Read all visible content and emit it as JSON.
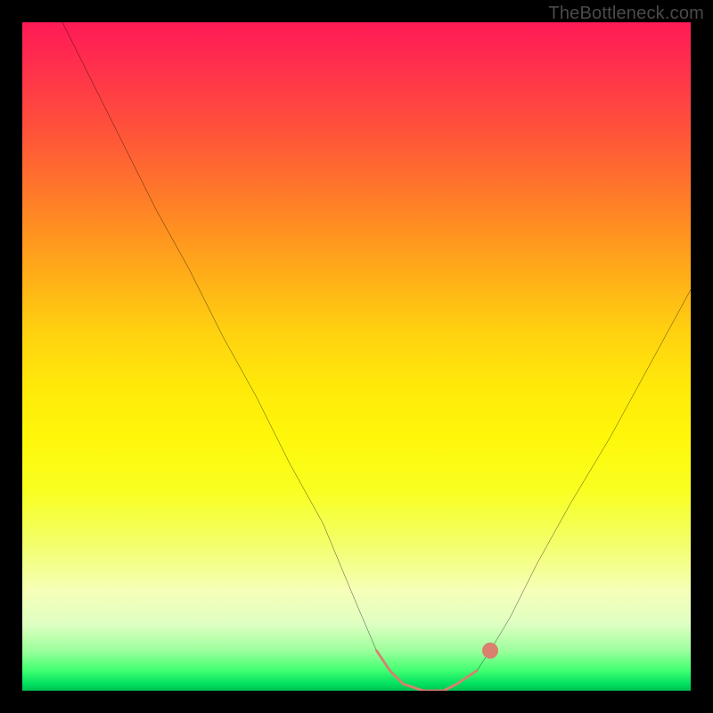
{
  "attribution": "TheBottleneck.com",
  "chart_data": {
    "type": "line",
    "title": "",
    "xlabel": "",
    "ylabel": "",
    "xlim": [
      0,
      100
    ],
    "ylim": [
      0,
      100
    ],
    "series": [
      {
        "name": "bottleneck-curve",
        "x": [
          6,
          10,
          15,
          20,
          25,
          30,
          35,
          40,
          45,
          50,
          53,
          55,
          57,
          60,
          63,
          65,
          68,
          70,
          73,
          77,
          82,
          88,
          94,
          100
        ],
        "y": [
          100,
          92,
          82,
          72,
          63,
          53,
          44,
          34,
          25,
          13,
          6,
          3,
          1,
          0,
          0,
          1,
          3,
          6,
          11,
          19,
          28,
          38,
          49,
          60
        ]
      }
    ],
    "highlight_region": {
      "x_start": 53,
      "x_end": 68,
      "color": "#d9806f"
    },
    "background_gradient": {
      "type": "vertical",
      "stops": [
        {
          "pos": 0.0,
          "color": "#ff1a55"
        },
        {
          "pos": 0.5,
          "color": "#ffe000"
        },
        {
          "pos": 0.85,
          "color": "#f6ffb8"
        },
        {
          "pos": 1.0,
          "color": "#00c050"
        }
      ]
    }
  }
}
